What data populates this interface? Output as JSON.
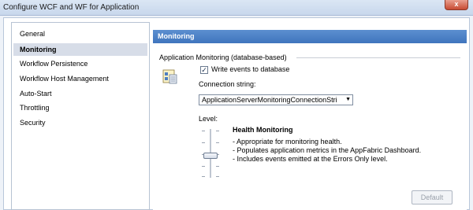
{
  "window": {
    "title": "Configure WCF and WF for Application",
    "close_glyph": "x"
  },
  "nav": {
    "items": [
      {
        "label": "General",
        "selected": false
      },
      {
        "label": "Monitoring",
        "selected": true
      },
      {
        "label": "Workflow Persistence",
        "selected": false
      },
      {
        "label": "Workflow Host Management",
        "selected": false
      },
      {
        "label": "Auto-Start",
        "selected": false
      },
      {
        "label": "Throttling",
        "selected": false
      },
      {
        "label": "Security",
        "selected": false
      }
    ]
  },
  "panel": {
    "header": "Monitoring",
    "group_label": "Application Monitoring (database-based)",
    "icon": "database-icon",
    "write_events": {
      "label": "Write events to database",
      "checked": true
    },
    "connection_string": {
      "label": "Connection string:",
      "value": "ApplicationServerMonitoringConnectionStri"
    },
    "level": {
      "label": "Level:",
      "title": "Health Monitoring",
      "lines": [
        "- Appropriate for monitoring health.",
        "- Populates application metrics in the AppFabric Dashboard.",
        "- Includes events emitted at the Errors Only level."
      ],
      "slider_position_fraction": 0.55
    },
    "default_button": "Default"
  },
  "colors": {
    "header_blue": "#4a7fc4",
    "selected_nav": "#d7dde8",
    "close_red": "#c74a32"
  }
}
